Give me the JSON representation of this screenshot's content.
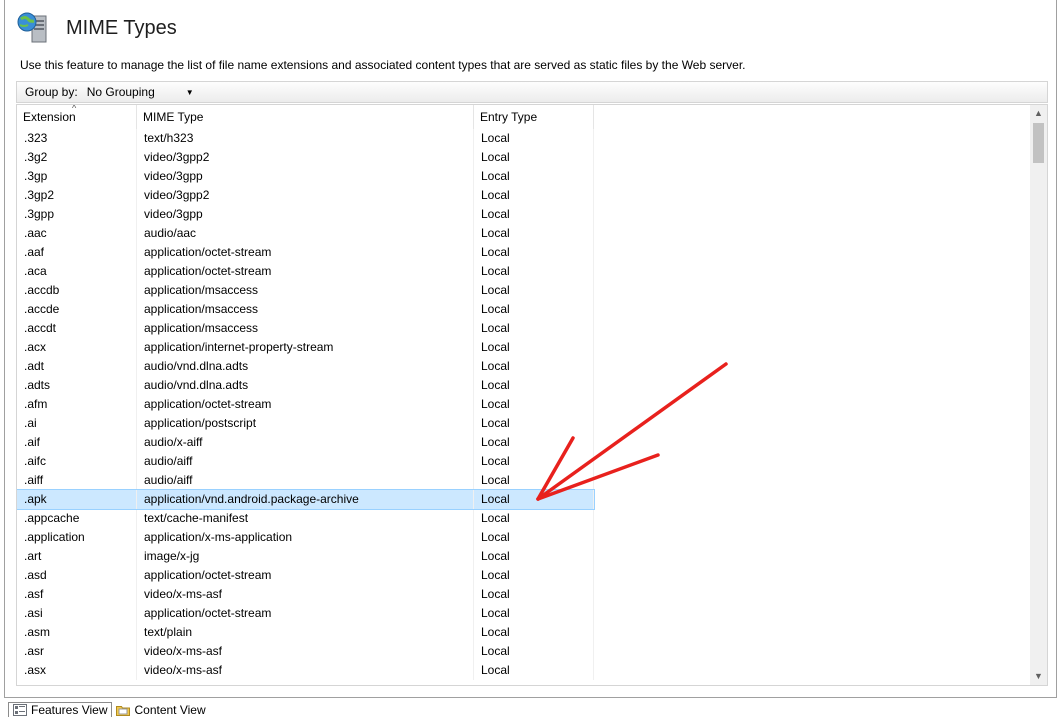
{
  "header": {
    "title": "MIME Types",
    "icon": "globe-server-icon"
  },
  "description": "Use this feature to manage the list of file name extensions and associated content types that are served as static files by the Web server.",
  "toolbar": {
    "group_by_label": "Group by:",
    "group_by_value": "No Grouping"
  },
  "table": {
    "columns": [
      "Extension",
      "MIME Type",
      "Entry Type"
    ],
    "selected_index": 19,
    "rows": [
      [
        ".323",
        "text/h323",
        "Local"
      ],
      [
        ".3g2",
        "video/3gpp2",
        "Local"
      ],
      [
        ".3gp",
        "video/3gpp",
        "Local"
      ],
      [
        ".3gp2",
        "video/3gpp2",
        "Local"
      ],
      [
        ".3gpp",
        "video/3gpp",
        "Local"
      ],
      [
        ".aac",
        "audio/aac",
        "Local"
      ],
      [
        ".aaf",
        "application/octet-stream",
        "Local"
      ],
      [
        ".aca",
        "application/octet-stream",
        "Local"
      ],
      [
        ".accdb",
        "application/msaccess",
        "Local"
      ],
      [
        ".accde",
        "application/msaccess",
        "Local"
      ],
      [
        ".accdt",
        "application/msaccess",
        "Local"
      ],
      [
        ".acx",
        "application/internet-property-stream",
        "Local"
      ],
      [
        ".adt",
        "audio/vnd.dlna.adts",
        "Local"
      ],
      [
        ".adts",
        "audio/vnd.dlna.adts",
        "Local"
      ],
      [
        ".afm",
        "application/octet-stream",
        "Local"
      ],
      [
        ".ai",
        "application/postscript",
        "Local"
      ],
      [
        ".aif",
        "audio/x-aiff",
        "Local"
      ],
      [
        ".aifc",
        "audio/aiff",
        "Local"
      ],
      [
        ".aiff",
        "audio/aiff",
        "Local"
      ],
      [
        ".apk",
        "application/vnd.android.package-archive",
        "Local"
      ],
      [
        ".appcache",
        "text/cache-manifest",
        "Local"
      ],
      [
        ".application",
        "application/x-ms-application",
        "Local"
      ],
      [
        ".art",
        "image/x-jg",
        "Local"
      ],
      [
        ".asd",
        "application/octet-stream",
        "Local"
      ],
      [
        ".asf",
        "video/x-ms-asf",
        "Local"
      ],
      [
        ".asi",
        "application/octet-stream",
        "Local"
      ],
      [
        ".asm",
        "text/plain",
        "Local"
      ],
      [
        ".asr",
        "video/x-ms-asf",
        "Local"
      ],
      [
        ".asx",
        "video/x-ms-asf",
        "Local"
      ]
    ]
  },
  "bottom_tabs": [
    {
      "label": "Features View",
      "icon": "features-view-icon"
    },
    {
      "label": "Content View",
      "icon": "content-view-icon"
    }
  ],
  "colors": {
    "selection": "#cce8ff",
    "annotation_arrow": "#e8211d"
  }
}
